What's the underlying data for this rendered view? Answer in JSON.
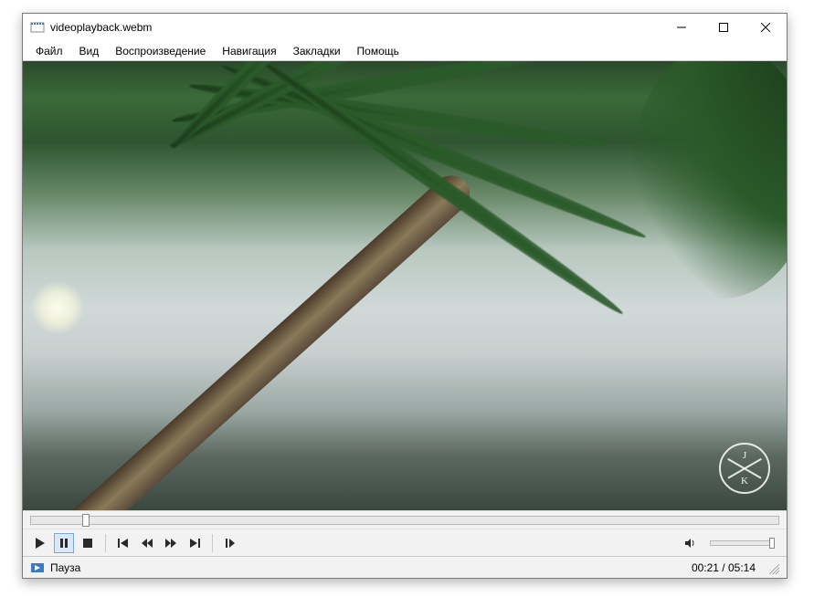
{
  "window": {
    "title": "videoplayback.webm"
  },
  "menu": {
    "items": [
      "Файл",
      "Вид",
      "Воспроизведение",
      "Навигация",
      "Закладки",
      "Помощь"
    ]
  },
  "watermark": {
    "top": "J",
    "bottom": "K"
  },
  "playback": {
    "position_percent": 6.8,
    "current_time": "00:21",
    "total_time": "05:14"
  },
  "status": {
    "text": "Пауза",
    "time_display": "00:21 / 05:14"
  },
  "volume": {
    "percent": 100
  }
}
